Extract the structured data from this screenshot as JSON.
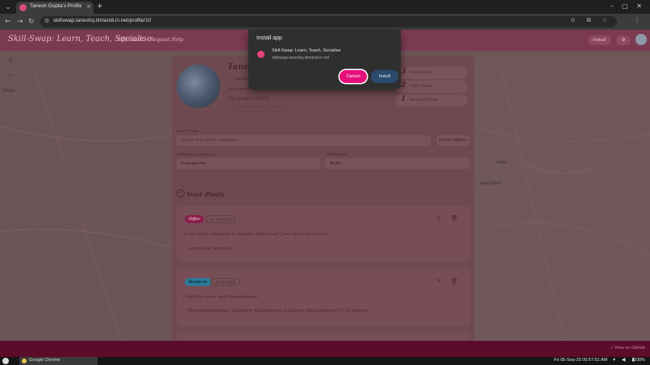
{
  "browser": {
    "tab_title": "Tanesh Gupta's Profile - Sk",
    "tab_close": "×",
    "new_tab": "+",
    "url": "skillswap.taneshq.iitmandi.in.net/profile/10"
  },
  "site": {
    "brand": "Skill-Swap: Learn, Teach, Socialise",
    "nav_offer": "Offer Skill",
    "nav_request": "Request Help",
    "install_btn": "Install"
  },
  "map": {
    "labels": [
      "Chhata",
      "New Delhi",
      "Delhi"
    ],
    "zoom_in": "+",
    "zoom_out": "−"
  },
  "profile": {
    "name": "Tanesh",
    "badge": "Top Hel",
    "email": "tanesh",
    "pincode": "Pin Code: 110078",
    "hint": "Click profile picture to change",
    "stats": [
      {
        "num": "3",
        "label": "Total Posts"
      },
      {
        "num": "2",
        "label": "Offer Posts"
      },
      {
        "num": "1",
        "label": "Request Posts"
      }
    ]
  },
  "filters": {
    "search_label": "Search Posts",
    "search_placeholder": "Search descriptions, categories...",
    "clear": "Clear Filters",
    "category_label": "Categories (or/and/any)",
    "category_value": "Categories",
    "type_label": "Offer/Request",
    "type_value": "Both"
  },
  "posts": {
    "title": "Your Posts",
    "items": [
      {
        "type": "Offer",
        "id": "110078",
        "desc": "I can teach japanese to anyone interested! Just shoot me a mail.",
        "tags": [
          "Language Teaching"
        ]
      },
      {
        "type": "Request",
        "id": "110085",
        "desc": "I wish to learn web development",
        "tags": [
          "Web Development",
          "Software Engineering",
          "Database Management",
          "UI/UX Design"
        ]
      }
    ]
  },
  "dialog": {
    "title": "Install app",
    "app_name": "Skill-Swap: Learn, Teach, Socialise",
    "app_url": "skillswap.taneshq.iitmandi.in.net",
    "cancel": "Cancel",
    "install": "Install"
  },
  "footer": {
    "github": "View on GitHub"
  },
  "taskbar": {
    "app": "Google Chrome",
    "clock": "Fri 05-Sep-25 00:57:51 AM",
    "battery": "100%"
  }
}
